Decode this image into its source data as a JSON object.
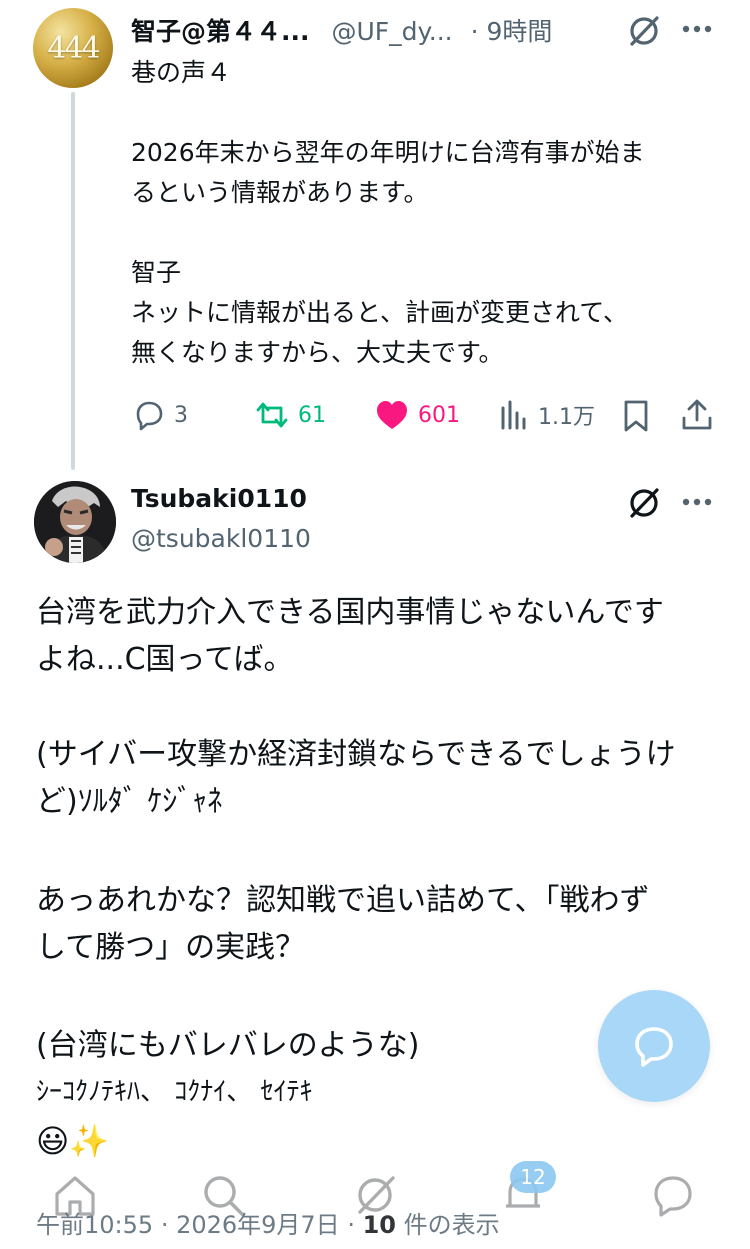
{
  "parent_tweet": {
    "avatar_text": "444",
    "name": "智子@第４４...",
    "handle": "@UF_dy...",
    "time": "· 9時間",
    "body": "巷の声４\n\n2026年末から翌年の年明けに台湾有事が始ま\nるという情報があります。\n\n智子\nネットに情報が出ると、計画が変更されて、\n無くなりますから、大丈夫です。",
    "reply_count": "3",
    "repost_count": "61",
    "like_count": "601",
    "view_count": "1.1万",
    "icons": [
      "grok-icon",
      "more-icon",
      "reply-icon",
      "repost-icon",
      "heart-icon",
      "views-icon",
      "bookmark-icon",
      "share-icon"
    ],
    "colors": {
      "repost": "#00ba7c",
      "like": "#f91880",
      "muted": "#536471"
    }
  },
  "main_tweet": {
    "name": "Tsubaki0110",
    "handle": "@tsubakl0110",
    "paragraphs": [
      "台湾を武力介入できる国内事情じゃないんです\nよね...C国ってば。",
      "(サイバー攻撃か経済封鎖ならできるでしょうけ\nど)ｿﾙﾀﾞ ｹｼﾞｬﾈ",
      "あっあれかな？認知戦で追い詰めて、「戦わず\nして勝つ」の実践？",
      "(台湾にもバレバレのような)"
    ],
    "halfwidth_line": "ｼｰｺｸﾉﾃｷﾊ、 ｺｸﾅｲ、 ｾｲﾃｷ",
    "emoji": "😃✨"
  },
  "meta": {
    "time": "午前10:55",
    "date": "· 2026年9月7日 ·",
    "views_count": "10",
    "views_label": "件の表示"
  },
  "bottom_nav": {
    "items": [
      "home-icon",
      "search-icon",
      "grok-icon",
      "notifications-icon",
      "messages-icon"
    ],
    "notification_badge": "12"
  },
  "accent_color": "#1d9bf0"
}
